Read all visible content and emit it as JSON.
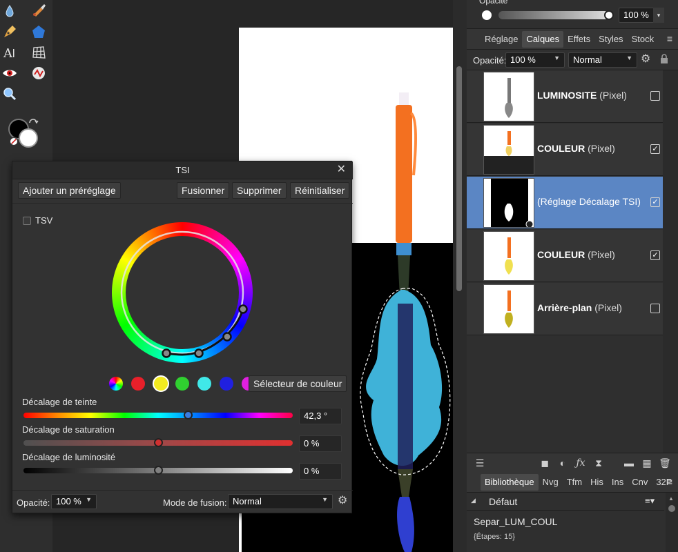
{
  "colors": {
    "selection": "#5b86c4",
    "panel": "#2f2f2f",
    "dialog": "#323232"
  },
  "top_panel": {
    "label": "Opacité",
    "value": "100 %"
  },
  "tabs_top": {
    "items": [
      "Réglage",
      "Calques",
      "Effets",
      "Styles",
      "Stock"
    ],
    "active": "Calques"
  },
  "layers_header": {
    "opacity_label": "Opacité:",
    "opacity_value": "100 %",
    "blend_mode": "Normal"
  },
  "layers": [
    {
      "name": "LUMINOSITE",
      "type": "(Pixel)",
      "checked": false,
      "selected": false,
      "checkmark": ""
    },
    {
      "name": "COULEUR",
      "type": "(Pixel)",
      "checked": true,
      "selected": false,
      "checkmark": "✓"
    },
    {
      "name": "",
      "type": "(Réglage Décalage TSI)",
      "checked": true,
      "selected": true,
      "checkmark": "✓"
    },
    {
      "name": "COULEUR",
      "type": "(Pixel)",
      "checked": true,
      "selected": false,
      "checkmark": "✓"
    },
    {
      "name": "Arrière-plan",
      "type": "(Pixel)",
      "checked": false,
      "selected": false,
      "checkmark": ""
    }
  ],
  "tabs_bottom": {
    "items": [
      "Bibliothèque",
      "Nvg",
      "Tfm",
      "His",
      "Ins",
      "Cnv",
      "32P"
    ],
    "active": "Bibliothèque"
  },
  "library": {
    "category": "Défaut",
    "macro_name": "Separ_LUM_COUL",
    "macro_steps": "{Étapes: 15}"
  },
  "dialog": {
    "title": "TSI",
    "close": "✕",
    "add_preset": "Ajouter un préréglage",
    "merge": "Fusionner",
    "delete": "Supprimer",
    "reset": "Réinitialiser",
    "tsv_label": "TSV",
    "color_picker": "Sélecteur de couleur",
    "hue_label": "Décalage de teinte",
    "hue_value": "42,3 °",
    "hue_level": 0.61,
    "saturation_label": "Décalage de saturation",
    "saturation_value": "0 %",
    "saturation_level": 0.5,
    "luminosity_label": "Décalage de luminosité",
    "luminosity_value": "0 %",
    "luminosity_level": 0.5,
    "opacity_label": "Opacité:",
    "opacity_value": "100 %",
    "blend_label": "Mode de fusion:",
    "blend_value": "Normal"
  },
  "icons": [
    "dropper-icon",
    "brush-icon",
    "pen-icon",
    "polygon-icon",
    "text-icon",
    "mesh-icon",
    "redeye-icon",
    "vector-icon",
    "zoom-icon",
    "swap-icon",
    "gear-icon",
    "lock-icon",
    "menu-icon",
    "close-icon",
    "checkbox-icon"
  ]
}
